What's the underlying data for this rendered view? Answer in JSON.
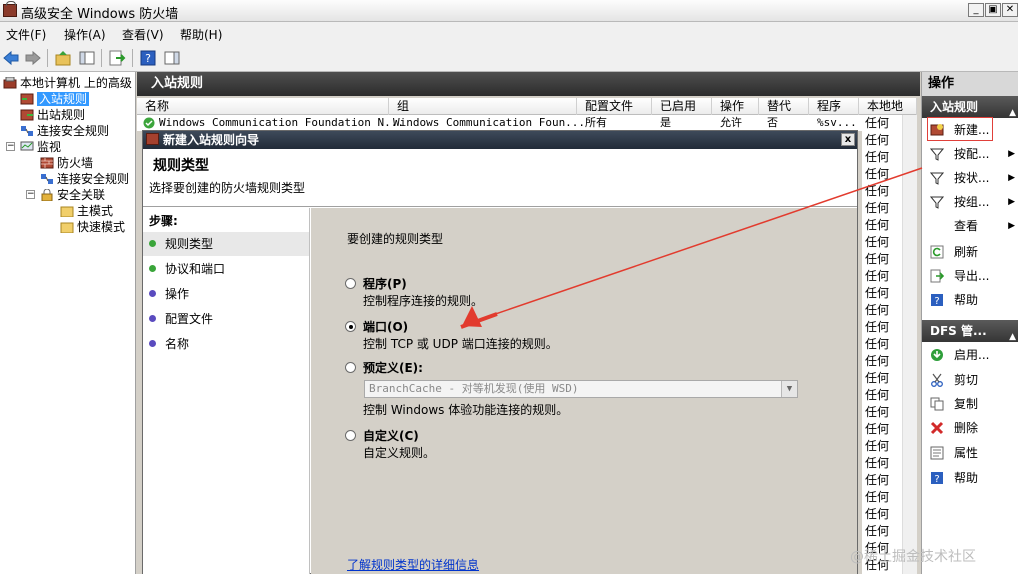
{
  "window": {
    "title": "高级安全 Windows 防火墙"
  },
  "menu": [
    "文件(F)",
    "操作(A)",
    "查看(V)",
    "帮助(H)"
  ],
  "tree": {
    "root": "本地计算机 上的高级",
    "inbound": "入站规则",
    "outbound": "出站规则",
    "conn_sec": "连接安全规则",
    "monitor": "监视",
    "firewall": "防火墙",
    "conn_sec2": "连接安全规则",
    "sec_assoc": "安全关联",
    "main_mode": "主模式",
    "quick_mode": "快速模式"
  },
  "middle": {
    "header": "入站规则",
    "columns": [
      "名称",
      "组",
      "配置文件",
      "已启用",
      "操作",
      "替代",
      "程序",
      "本地地"
    ],
    "first_row": {
      "name": "Windows Communication Foundation N...",
      "group": "Windows Communication Foun...",
      "profile": "所有",
      "enabled": "是",
      "action": "允许",
      "override": "否",
      "program": "%sv..."
    },
    "any_label": "任何"
  },
  "wizard": {
    "title": "新建入站规则向导",
    "close": "x",
    "heading": "规则类型",
    "subheading": "选择要创建的防火墙规则类型",
    "steps_title": "步骤:",
    "steps": [
      "规则类型",
      "协议和端口",
      "操作",
      "配置文件",
      "名称"
    ],
    "prompt": "要创建的规则类型",
    "options": [
      {
        "label": "程序(P)",
        "desc": "控制程序连接的规则。"
      },
      {
        "label": "端口(O)",
        "desc": "控制 TCP 或 UDP 端口连接的规则。"
      },
      {
        "label": "预定义(E):",
        "desc": "控制 Windows 体验功能连接的规则。"
      },
      {
        "label": "自定义(C)",
        "desc": "自定义规则。"
      }
    ],
    "selected_option": 1,
    "predefined_value": "BranchCache - 对等机发现(使用 WSD)",
    "learn_link": "了解规则类型的详细信息"
  },
  "actions": {
    "title": "操作",
    "section1": "入站规则",
    "items1": [
      "新建...",
      "按配...",
      "按状...",
      "按组...",
      "查看",
      "刷新",
      "导出...",
      "帮助"
    ],
    "section2": "DFS 管...",
    "items2": [
      "启用...",
      "剪切",
      "复制",
      "删除",
      "属性",
      "帮助"
    ]
  },
  "watermark": "@稀土掘金技术社区",
  "colors": {
    "accent": "#3399ff",
    "header_dark": "#2c2c2c",
    "highlight_red": "#e0403a"
  }
}
